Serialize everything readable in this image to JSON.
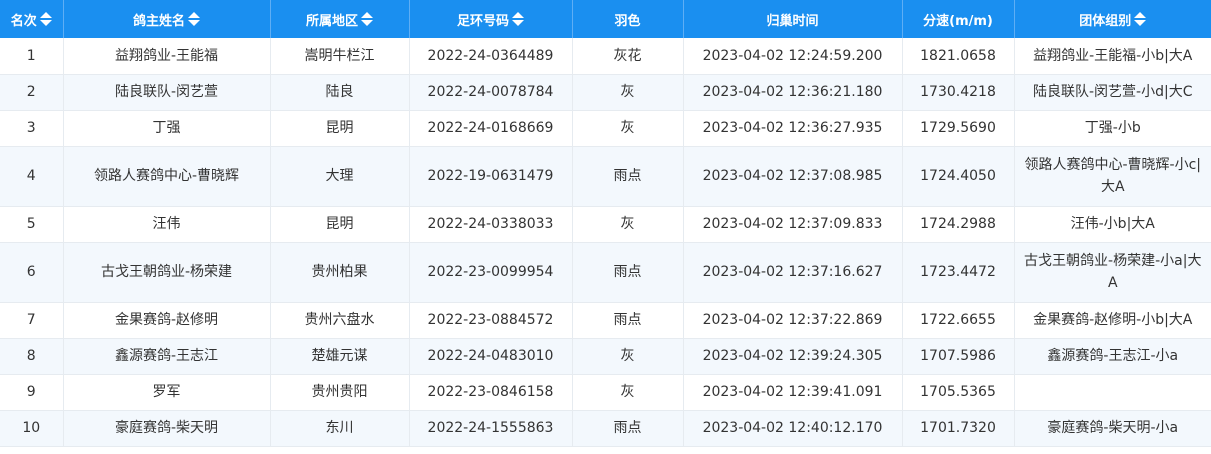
{
  "table": {
    "columns": [
      {
        "label": "名次",
        "sortable": true
      },
      {
        "label": "鸽主姓名",
        "sortable": true
      },
      {
        "label": "所属地区",
        "sortable": true
      },
      {
        "label": "足环号码",
        "sortable": true
      },
      {
        "label": "羽色",
        "sortable": false
      },
      {
        "label": "归巢时间",
        "sortable": false
      },
      {
        "label": "分速(m/m)",
        "sortable": false
      },
      {
        "label": "团体组别",
        "sortable": true
      }
    ],
    "rows": [
      [
        "1",
        "益翔鸽业-王能福",
        "嵩明牛栏江",
        "2022-24-0364489",
        "灰花",
        "2023-04-02 12:24:59.200",
        "1821.0658",
        "益翔鸽业-王能福-小b|大A"
      ],
      [
        "2",
        "陆良联队-闵艺萱",
        "陆良",
        "2022-24-0078784",
        "灰",
        "2023-04-02 12:36:21.180",
        "1730.4218",
        "陆良联队-闵艺萱-小d|大C"
      ],
      [
        "3",
        "丁强",
        "昆明",
        "2022-24-0168669",
        "灰",
        "2023-04-02 12:36:27.935",
        "1729.5690",
        "丁强-小b"
      ],
      [
        "4",
        "领路人赛鸽中心-曹晓辉",
        "大理",
        "2022-19-0631479",
        "雨点",
        "2023-04-02 12:37:08.985",
        "1724.4050",
        "领路人赛鸽中心-曹晓辉-小c|大A"
      ],
      [
        "5",
        "汪伟",
        "昆明",
        "2022-24-0338033",
        "灰",
        "2023-04-02 12:37:09.833",
        "1724.2988",
        "汪伟-小b|大A"
      ],
      [
        "6",
        "古戈王朝鸽业-杨荣建",
        "贵州柏果",
        "2022-23-0099954",
        "雨点",
        "2023-04-02 12:37:16.627",
        "1723.4472",
        "古戈王朝鸽业-杨荣建-小a|大A"
      ],
      [
        "7",
        "金果赛鸽-赵修明",
        "贵州六盘水",
        "2022-23-0884572",
        "雨点",
        "2023-04-02 12:37:22.869",
        "1722.6655",
        "金果赛鸽-赵修明-小b|大A"
      ],
      [
        "8",
        "鑫源赛鸽-王志江",
        "楚雄元谋",
        "2022-24-0483010",
        "灰",
        "2023-04-02 12:39:24.305",
        "1707.5986",
        "鑫源赛鸽-王志江-小a"
      ],
      [
        "9",
        "罗军",
        "贵州贵阳",
        "2022-23-0846158",
        "灰",
        "2023-04-02 12:39:41.091",
        "1705.5365",
        ""
      ],
      [
        "10",
        "豪庭赛鸽-柴天明",
        "东川",
        "2022-24-1555863",
        "雨点",
        "2023-04-02 12:40:12.170",
        "1701.7320",
        "豪庭赛鸽-柴天明-小a"
      ]
    ]
  }
}
